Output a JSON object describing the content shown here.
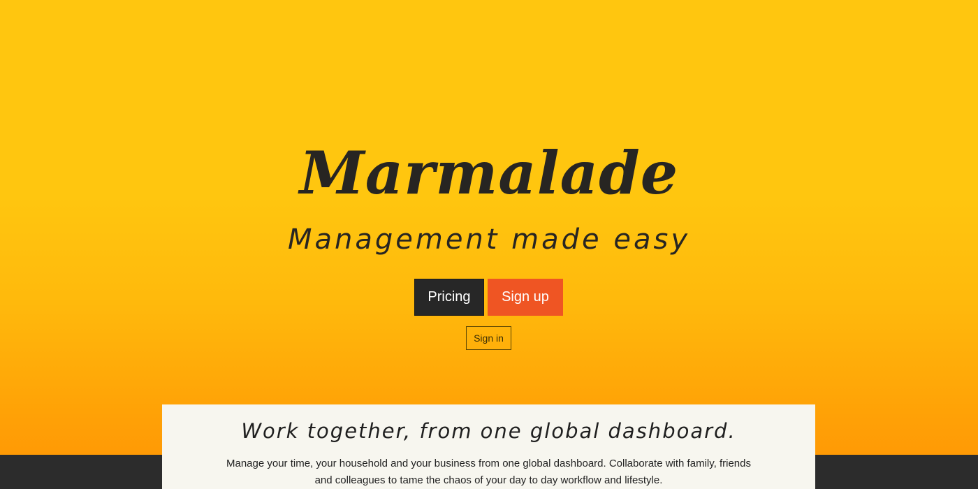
{
  "hero": {
    "brand": "Marmalade",
    "tagline": "Management made easy",
    "buttons": {
      "pricing": "Pricing",
      "signup": "Sign up"
    },
    "signin": "Sign in"
  },
  "feature": {
    "heading": "Work together, from one global dashboard.",
    "body_line1": "Manage your time, your household and your business from one global dashboard. Collaborate with family, friends",
    "body_line2": "and colleagues to tame the chaos of your day to day workflow and lifestyle."
  },
  "colors": {
    "background_top": "#ffc60f",
    "background_bottom": "#ff9a05",
    "pricing_button": "#272727",
    "signup_button": "#ef5523",
    "card_background": "#f7f6ef",
    "footer_band": "#2c2c2c"
  }
}
